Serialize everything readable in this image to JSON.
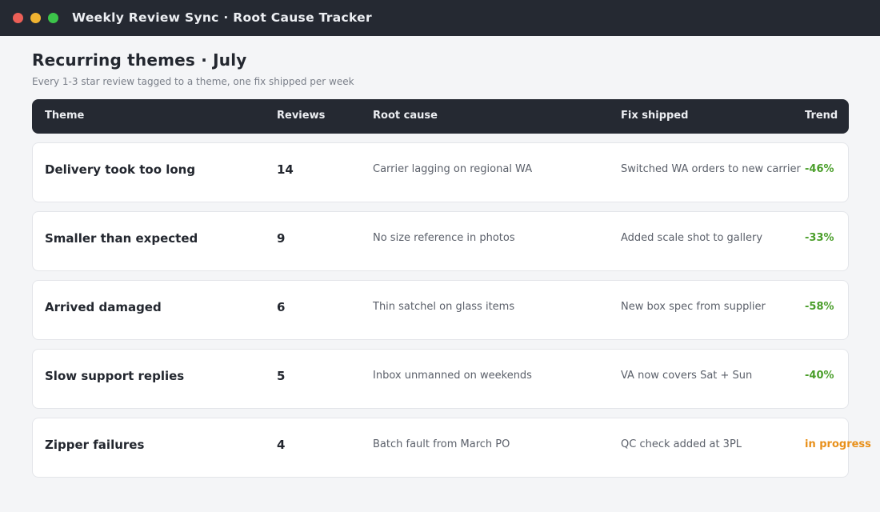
{
  "window": {
    "title": "Weekly Review Sync  ·  Root Cause Tracker",
    "controls": [
      "close",
      "minimize",
      "maximize"
    ]
  },
  "page": {
    "title": "Recurring themes · July",
    "subtitle": "Every 1-3 star review tagged to a theme, one fix shipped per week"
  },
  "table": {
    "columns": {
      "theme": "Theme",
      "reviews": "Reviews",
      "cause": "Root cause",
      "fix": "Fix shipped",
      "trend": "Trend"
    },
    "rows": [
      {
        "theme": "Delivery took too long",
        "reviews": "14",
        "cause": "Carrier lagging on regional WA",
        "fix": "Switched WA orders to new carrier",
        "trend": "-46%",
        "trend_color": "#4a9e2a"
      },
      {
        "theme": "Smaller than expected",
        "reviews": "9",
        "cause": "No size reference in photos",
        "fix": "Added scale shot to gallery",
        "trend": "-33%",
        "trend_color": "#4a9e2a"
      },
      {
        "theme": "Arrived damaged",
        "reviews": "6",
        "cause": "Thin satchel on glass items",
        "fix": "New box spec from supplier",
        "trend": "-58%",
        "trend_color": "#4a9e2a"
      },
      {
        "theme": "Slow support replies",
        "reviews": "5",
        "cause": "Inbox unmanned on weekends",
        "fix": "VA now covers Sat + Sun",
        "trend": "-40%",
        "trend_color": "#4a9e2a"
      },
      {
        "theme": "Zipper failures",
        "reviews": "4",
        "cause": "Batch fault from March PO",
        "fix": "QC check added at 3PL",
        "trend": "in progress",
        "trend_color": "#e8901a"
      }
    ]
  },
  "colors": {
    "titlebar": "#252932",
    "background": "#f4f5f7",
    "trend_down": "#4a9e2a",
    "trend_in_progress": "#e8901a"
  }
}
